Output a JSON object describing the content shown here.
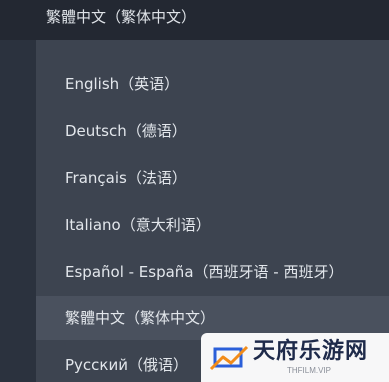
{
  "dropdown": {
    "selected_value": "繁體中文（繁体中文）",
    "options": [
      {
        "label": "English（英语）"
      },
      {
        "label": "Deutsch（德语）"
      },
      {
        "label": "Français（法语）"
      },
      {
        "label": "Italiano（意大利语）"
      },
      {
        "label": "Español - España（西班牙语 - 西班牙）"
      },
      {
        "label": "繁體中文（繁体中文）"
      },
      {
        "label": "Русский（俄语）"
      }
    ]
  },
  "watermark": {
    "title": "天府乐游网",
    "subtitle": "THFILM.VIP"
  },
  "colors": {
    "page_background": "#2b323e",
    "header_background": "#232832",
    "list_background": "#3d4450",
    "selected_background": "#4a515e",
    "text": "#e3e7ec",
    "logo_blue": "#2b5fd9",
    "logo_orange": "#f28c1a"
  }
}
